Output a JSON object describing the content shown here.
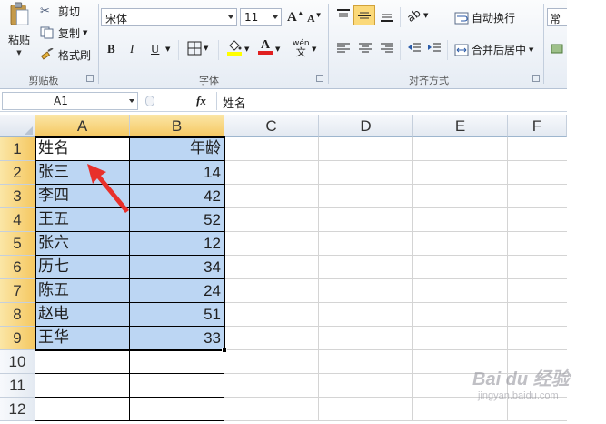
{
  "ribbon": {
    "clipboard": {
      "paste_label": "粘贴",
      "cut_label": "剪切",
      "copy_label": "复制",
      "format_painter_label": "格式刷",
      "group_title": "剪贴板"
    },
    "font": {
      "font_name": "宋体",
      "font_size": "11",
      "bold": "B",
      "italic": "I",
      "underline": "U",
      "group_title": "字体",
      "font_color": "#e02020",
      "fill_color": "#ffff00"
    },
    "alignment": {
      "wrap_text_label": "自动换行",
      "merge_center_label": "合并后居中",
      "group_title": "对齐方式"
    },
    "number": {
      "format_label": "常规"
    }
  },
  "formula_bar": {
    "name_box": "A1",
    "fx": "fx",
    "content": "姓名"
  },
  "columns": [
    "A",
    "B",
    "C",
    "D",
    "E",
    "F"
  ],
  "rows": [
    "1",
    "2",
    "3",
    "4",
    "5",
    "6",
    "7",
    "8",
    "9",
    "10",
    "11",
    "12"
  ],
  "cells": {
    "A": [
      "姓名",
      "张三",
      "李四",
      "王五",
      "张六",
      "历七",
      "陈五",
      "赵电",
      "王华"
    ],
    "B": [
      "年龄",
      "14",
      "42",
      "52",
      "12",
      "34",
      "24",
      "51",
      "33"
    ]
  },
  "colors": {
    "selection": "#bcd6f3",
    "header_selected": "#f5c862",
    "annotation_arrow": "#e8302a"
  },
  "watermark": {
    "brand": "Bai du 经验",
    "url": "jingyan.baidu.com"
  }
}
